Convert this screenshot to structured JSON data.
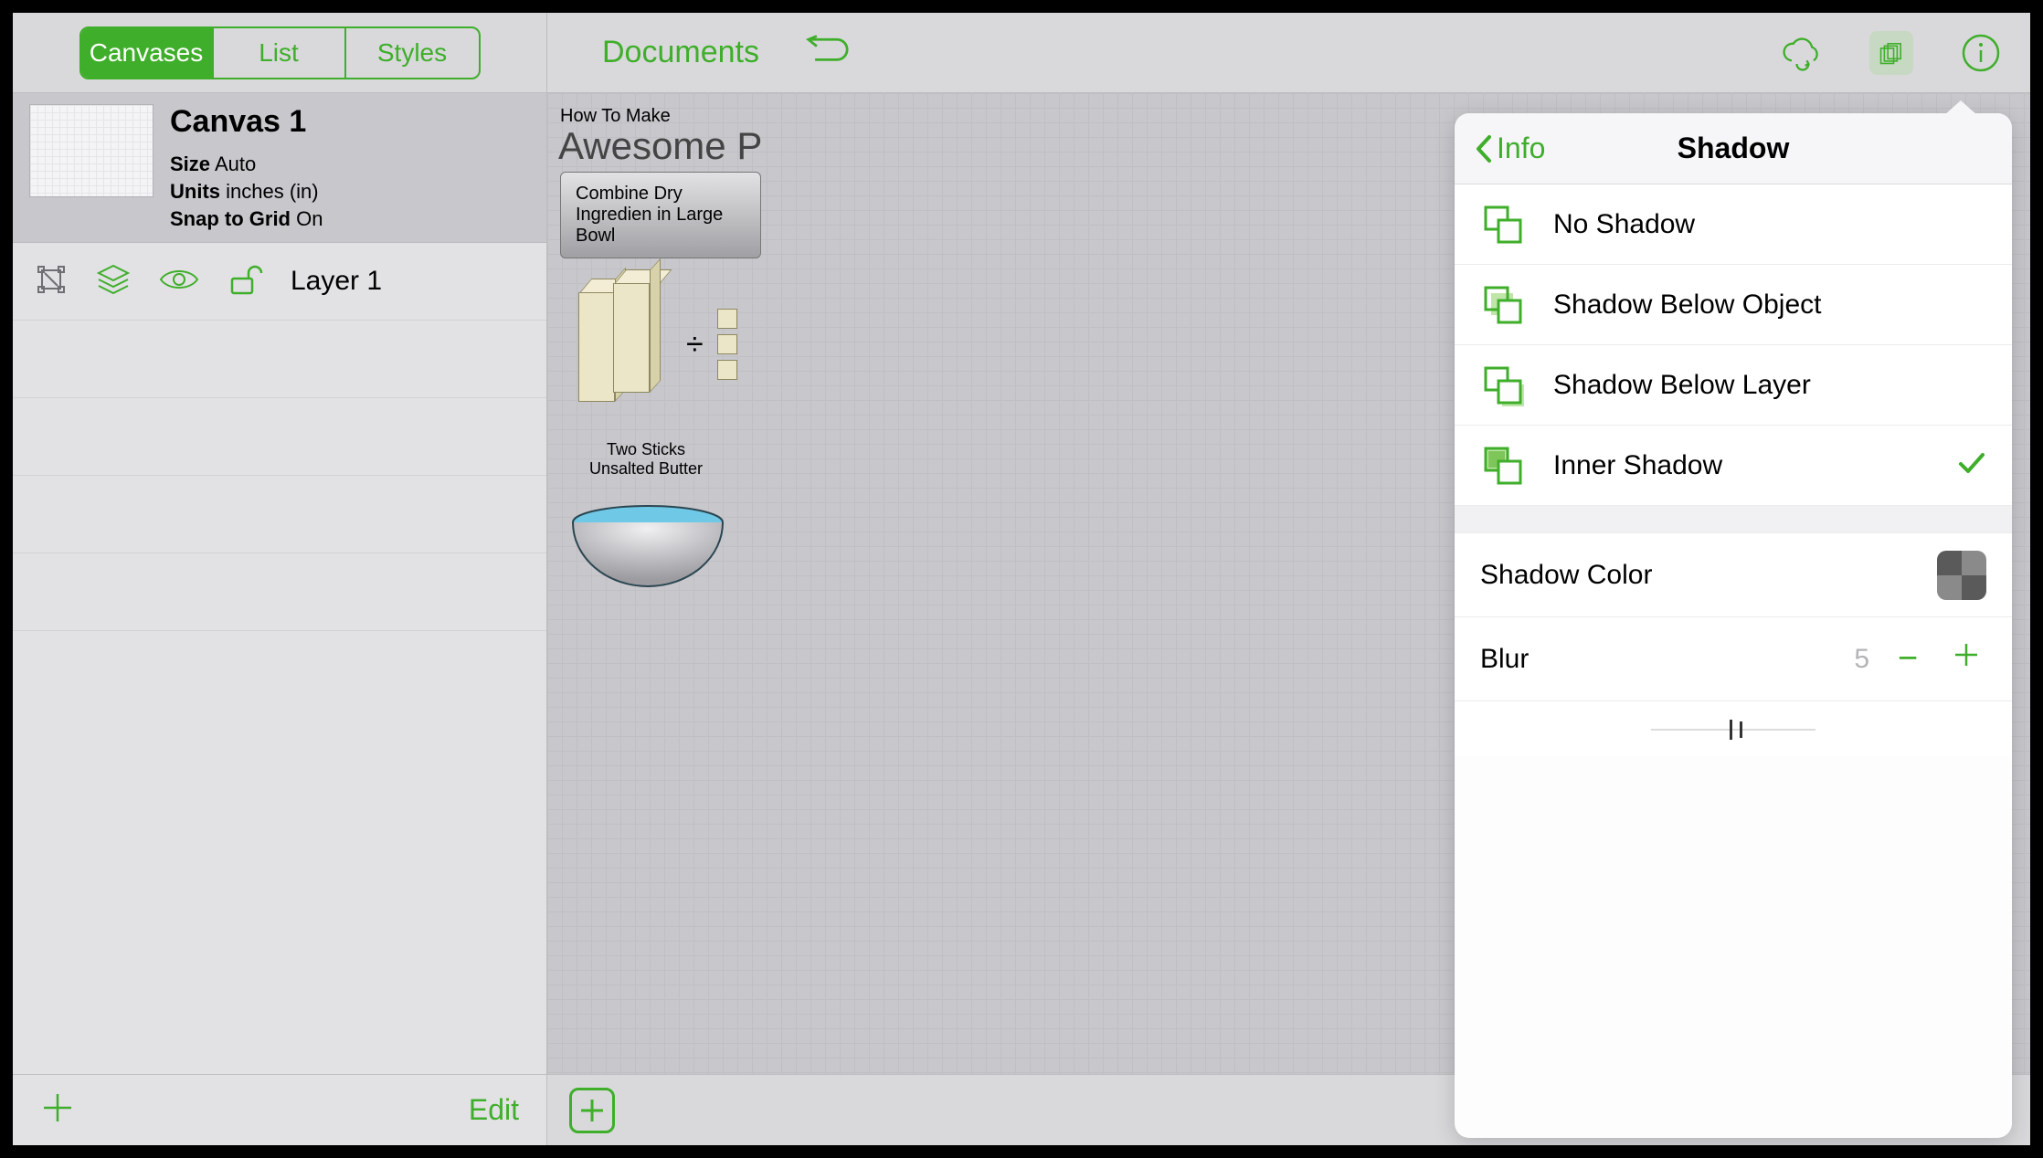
{
  "sidebar": {
    "tabs": [
      "Canvases",
      "List",
      "Styles"
    ],
    "active_tab_index": 0,
    "canvas": {
      "title": "Canvas 1",
      "meta": [
        {
          "label": "Size",
          "value": "Auto"
        },
        {
          "label": "Units",
          "value": "inches (in)"
        },
        {
          "label": "Snap to Grid",
          "value": "On"
        }
      ]
    },
    "layer": {
      "name": "Layer 1"
    },
    "edit_label": "Edit"
  },
  "main": {
    "title": "Documents",
    "doc_super": "How To Make",
    "doc_title": "Awesome P",
    "step_text": "Combine Dry Ingredien in Large Bowl",
    "butter_label_1": "Two Sticks",
    "butter_label_2": "Unsalted Butter"
  },
  "popover": {
    "back_label": "Info",
    "title": "Shadow",
    "options": [
      {
        "id": "no-shadow",
        "label": "No Shadow",
        "selected": false
      },
      {
        "id": "below-object",
        "label": "Shadow Below Object",
        "selected": false
      },
      {
        "id": "below-layer",
        "label": "Shadow Below Layer",
        "selected": false
      },
      {
        "id": "inner",
        "label": "Inner Shadow",
        "selected": true
      }
    ],
    "shadow_color_label": "Shadow Color",
    "blur_label": "Blur",
    "blur_value": "5"
  },
  "icons": {
    "undo": "undo-icon",
    "cloud": "cloud-sync-icon",
    "stack": "canvases-stack-icon",
    "info": "info-icon",
    "add": "plus-icon",
    "draw": "draw-shape-icon",
    "selection": "selection-icon",
    "layers": "layers-icon",
    "eye": "visibility-icon",
    "lock": "unlocked-icon"
  }
}
